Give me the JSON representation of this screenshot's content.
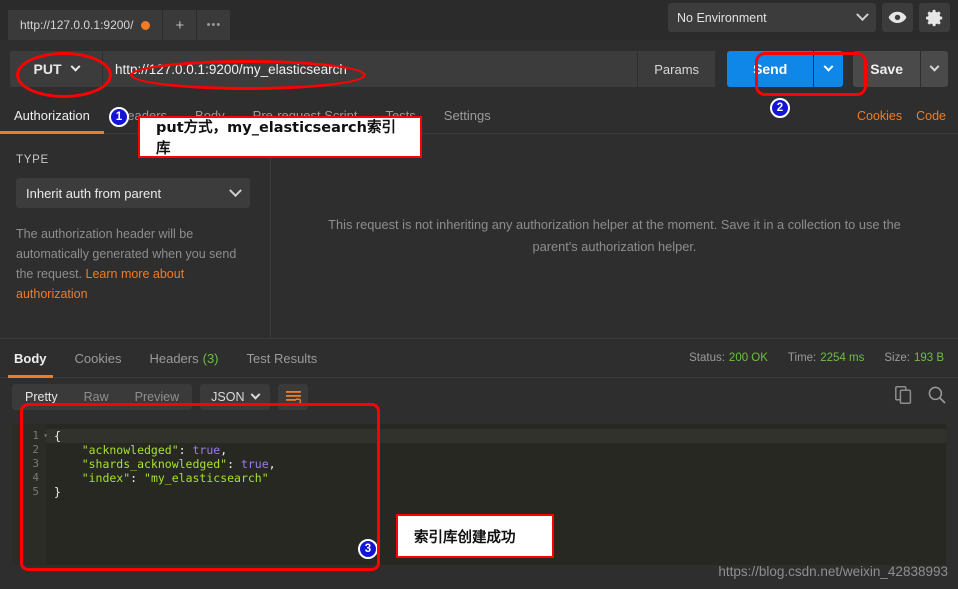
{
  "window": {
    "request_tab_title": "http://127.0.0.1:9200/",
    "new_tab_label": "+",
    "more_tabs_label": "•••"
  },
  "environment": {
    "selected": "No Environment",
    "eye_icon": "eye-icon",
    "gear_icon": "gear-icon"
  },
  "request": {
    "method": "PUT",
    "url": "http://127.0.0.1:9200/my_elasticsearch",
    "params_label": "Params",
    "send_label": "Send",
    "save_label": "Save"
  },
  "request_tabs": [
    {
      "label": "Authorization",
      "active": true
    },
    {
      "label": "Headers",
      "active": false
    },
    {
      "label": "Body",
      "active": false
    },
    {
      "label": "Pre-request Script",
      "active": false
    },
    {
      "label": "Tests",
      "active": false
    },
    {
      "label": "Settings",
      "active": false
    }
  ],
  "request_links": {
    "cookies": "Cookies",
    "code": "Code"
  },
  "authorization": {
    "type_label": "TYPE",
    "type_value": "Inherit auth from parent",
    "help_text": "The authorization header will be automatically generated when you send the request. ",
    "help_link": "Learn more about authorization",
    "panel_message": "This request is not inheriting any authorization helper at the moment. Save it in a collection to use the parent's authorization helper."
  },
  "response_tabs": [
    {
      "label": "Body",
      "active": true,
      "count": ""
    },
    {
      "label": "Cookies",
      "active": false,
      "count": ""
    },
    {
      "label": "Headers",
      "active": false,
      "count": "(3)"
    },
    {
      "label": "Test Results",
      "active": false,
      "count": ""
    }
  ],
  "response_meta": {
    "status_label": "Status:",
    "status_value": "200 OK",
    "time_label": "Time:",
    "time_value": "2254 ms",
    "size_label": "Size:",
    "size_value": "193 B"
  },
  "response_toolbar": {
    "views": [
      {
        "label": "Pretty",
        "active": true
      },
      {
        "label": "Raw",
        "active": false
      },
      {
        "label": "Preview",
        "active": false
      }
    ],
    "format": "JSON",
    "wrap_icon": "text-wrap-icon",
    "copy_icon": "copy-icon",
    "search_icon": "search-icon"
  },
  "response_body": {
    "line_numbers": [
      "1",
      "2",
      "3",
      "4",
      "5"
    ],
    "lines": [
      {
        "segments": [
          {
            "t": "{",
            "c": "k-brace"
          }
        ]
      },
      {
        "segments": [
          {
            "t": "    \"acknowledged\"",
            "c": "k-key"
          },
          {
            "t": ": ",
            "c": "k-colon"
          },
          {
            "t": "true",
            "c": "k-bool"
          },
          {
            "t": ",",
            "c": "k-colon"
          }
        ]
      },
      {
        "segments": [
          {
            "t": "    \"shards_acknowledged\"",
            "c": "k-key"
          },
          {
            "t": ": ",
            "c": "k-colon"
          },
          {
            "t": "true",
            "c": "k-bool"
          },
          {
            "t": ",",
            "c": "k-colon"
          }
        ]
      },
      {
        "segments": [
          {
            "t": "    \"index\"",
            "c": "k-key"
          },
          {
            "t": ": ",
            "c": "k-colon"
          },
          {
            "t": "\"my_elasticsearch\"",
            "c": "k-str"
          }
        ]
      },
      {
        "segments": [
          {
            "t": "}",
            "c": "k-brace"
          }
        ]
      }
    ]
  },
  "annotations": {
    "note1": "put方式，my_elasticsearch索引库",
    "note2": "索引库创建成功",
    "badge1": "1",
    "badge2": "2",
    "badge3": "3",
    "highlight_color": "#ff0000",
    "badge_color": "#1414d8"
  },
  "watermark": "https://blog.csdn.net/weixin_42838993",
  "colors": {
    "accent_orange": "#f07c26",
    "send_blue": "#0f87e8",
    "status_green": "#6fbf3f",
    "app_bg": "#2e2e2e",
    "editor_bg": "#272822"
  }
}
